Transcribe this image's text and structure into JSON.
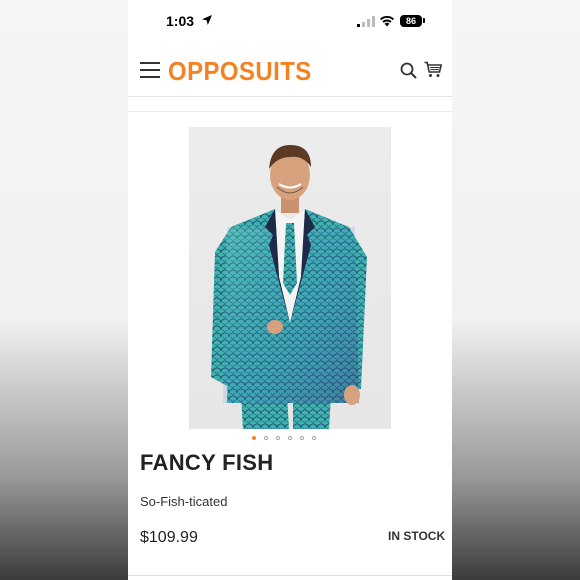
{
  "status_bar": {
    "time": "1:03",
    "battery": "86"
  },
  "header": {
    "logo": "OPPOSUITS"
  },
  "carousel": {
    "total_dots": 6,
    "active_index": 0
  },
  "product": {
    "title": "FANCY FISH",
    "subtitle": "So-Fish-ticated",
    "price": "$109.99",
    "stock": "IN STOCK"
  },
  "colors": {
    "accent": "#f58220",
    "suit": "#3fb4a8"
  },
  "icons": [
    "location-arrow-icon",
    "signal-icon",
    "wifi-icon",
    "battery-icon",
    "menu-icon",
    "search-icon",
    "cart-icon"
  ]
}
